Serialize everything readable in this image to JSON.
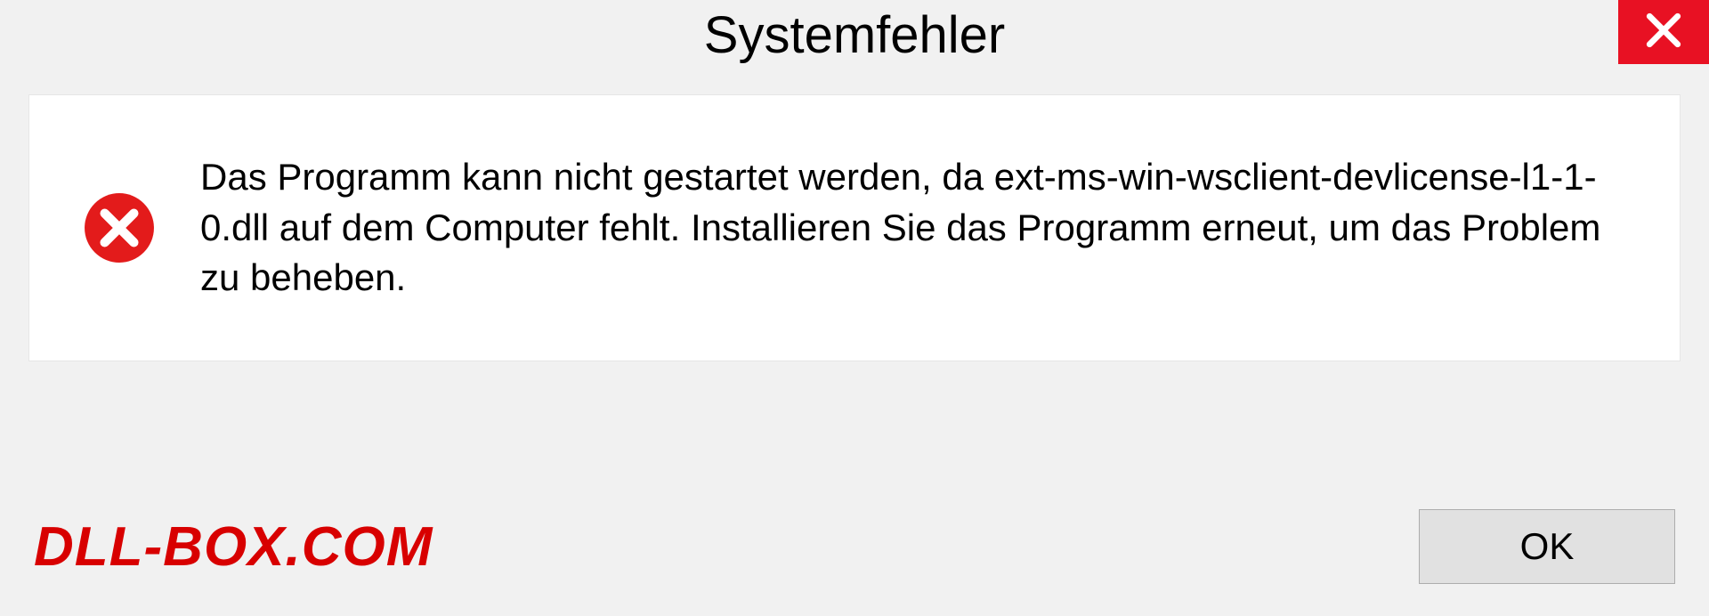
{
  "dialog": {
    "title": "Systemfehler",
    "message": "Das Programm kann nicht gestartet werden, da ext-ms-win-wsclient-devlicense-l1-1-0.dll auf dem Computer fehlt. Installieren Sie das Programm erneut, um das Problem zu beheben.",
    "ok_label": "OK"
  },
  "watermark": "DLL-BOX.COM"
}
